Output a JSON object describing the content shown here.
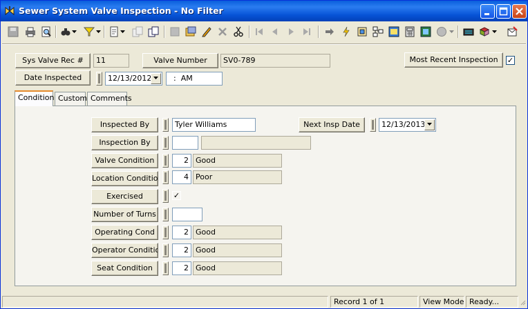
{
  "window": {
    "title": "Sewer System Valve Inspection - No Filter"
  },
  "toolbar": {
    "icons": [
      "save-icon",
      "print-icon",
      "print-preview-icon",
      "find-icon",
      "filter-icon",
      "new-record-icon",
      "copy-record-icon",
      "duplicate-icon",
      "delete-icon",
      "edit-icon",
      "pencil-icon",
      "cancel-icon",
      "cut-icon",
      "first-record-icon",
      "previous-record-icon",
      "next-record-icon",
      "last-record-icon",
      "goto-icon",
      "link-icon",
      "tree-icon",
      "report-icon",
      "calculator-icon",
      "map-icon",
      "globe-icon",
      "keyboard-icon",
      "book-icon",
      "exit-icon"
    ]
  },
  "header": {
    "sys_valve_rec_label": "Sys Valve Rec #",
    "sys_valve_rec_value": "11",
    "valve_number_label": "Valve Number",
    "valve_number_value": "SV0-789",
    "most_recent_label": "Most Recent Inspection",
    "most_recent_checked": "✓",
    "date_inspected_label": "Date Inspected",
    "date_inspected_value": "12/13/2012",
    "time_value": "  :  AM"
  },
  "tabs": [
    {
      "label": "Condition",
      "active": true
    },
    {
      "label": "Custom",
      "active": false
    },
    {
      "label": "Comments",
      "active": false
    }
  ],
  "condition": {
    "inspected_by_label": "Inspected By",
    "inspected_by_value": "Tyler Williams",
    "next_insp_label": "Next Insp Date",
    "next_insp_value": "12/13/2013",
    "inspection_by_label": "Inspection By",
    "inspection_by_code": "",
    "inspection_by_desc": "",
    "valve_condition_label": "Valve Condition",
    "valve_condition_code": "2",
    "valve_condition_desc": "Good",
    "location_condition_label": "Location Condition",
    "location_condition_code": "4",
    "location_condition_desc": "Poor",
    "exercised_label": "Exercised",
    "exercised_checked": "✓",
    "turns_label": "Number of Turns",
    "turns_value": "",
    "operating_cond_label": "Operating Cond",
    "operating_cond_code": "2",
    "operating_cond_desc": "Good",
    "operator_condition_label": "Operator Condition",
    "operator_condition_code": "2",
    "operator_condition_desc": "Good",
    "seat_condition_label": "Seat Condition",
    "seat_condition_code": "2",
    "seat_condition_desc": "Good"
  },
  "status": {
    "record": "Record 1 of 1",
    "mode": "View Mode",
    "ready": "Ready..."
  },
  "colors": {
    "title_bar": "#0653d6",
    "window_bg": "#ece9d8",
    "close_button": "#c84417"
  }
}
